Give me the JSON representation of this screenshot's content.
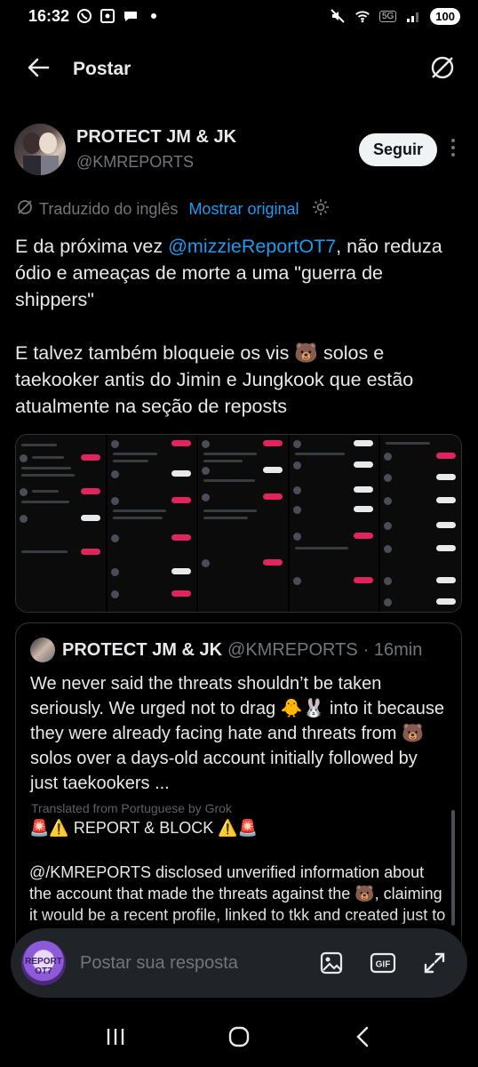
{
  "status": {
    "time": "16:32",
    "battery": "100",
    "network": "5G"
  },
  "header": {
    "title": "Postar",
    "back_icon": "arrow-left-icon",
    "grok_icon": "grok-icon"
  },
  "author": {
    "name": "PROTECT JM & JK",
    "handle": "@KMREPORTS",
    "follow_label": "Seguir"
  },
  "translation": {
    "label": "Traduzido do inglês",
    "link": "Mostrar original"
  },
  "tweet": {
    "part1": "E da próxima vez ",
    "mention": "@mizzieReportOT7",
    "part2": ", não reduza ódio e ameaças de morte a uma \"guerra de shippers\"\n\nE talvez também bloqueie os vis 🐻 solos e taekooker antis do Jimin e Jungkook que estão atualmente na seção de reposts"
  },
  "quote": {
    "name": "PROTECT JM & JK",
    "handle": "@KMREPORTS",
    "time": "· 16min",
    "text": "We never said the threats shouldn’t be taken seriously. We urged not to drag 🐥🐰 into it because they were already facing hate and threats from 🐻 solos over a days-old account initially followed by just taekookers ...",
    "nested": {
      "faded": "Translated from Portuguese by Grok",
      "title": "🚨⚠️ REPORT & BLOCK ⚠️🚨",
      "body": "@/KMREPORTS disclosed unverified information about the account that made the threats against the 🐻, claiming it would be a recent profile, linked to tkk and created just to"
    }
  },
  "reply": {
    "placeholder": "Postar sua resposta",
    "avatar_text": "REPORT OT7"
  }
}
